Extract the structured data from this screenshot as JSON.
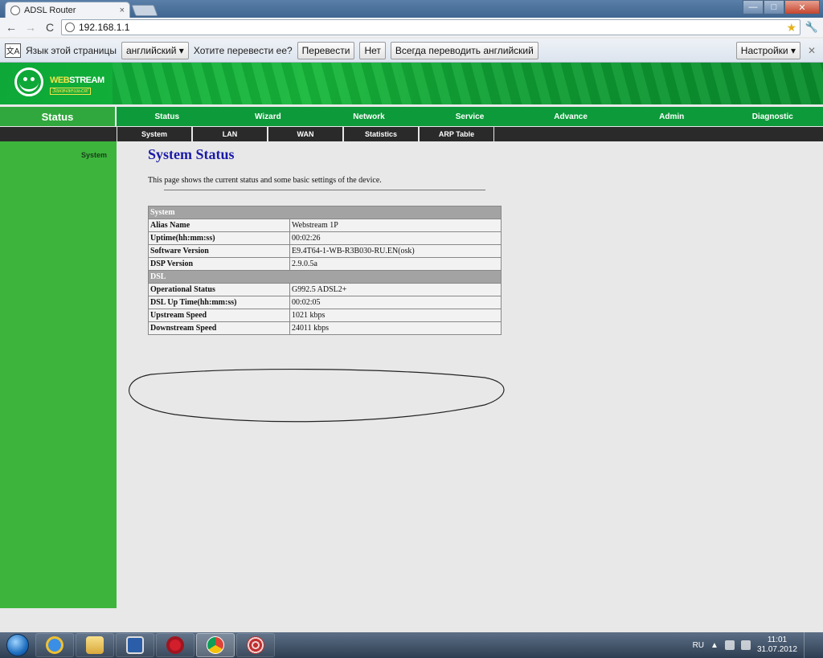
{
  "browser": {
    "tab_title": "ADSL Router",
    "tab_close": "×",
    "url": "192.168.1.1",
    "back": "←",
    "forward": "→",
    "reload": "C",
    "star": "★",
    "wrench": "🔧",
    "window_controls": {
      "minimize": "—",
      "maximize": "□",
      "close": "✕"
    }
  },
  "translate_bar": {
    "label": "Язык этой страницы",
    "language": "английский",
    "question": "Хотите перевести ее?",
    "translate_button": "Перевести",
    "no_button": "Нет",
    "always_button": "Всегда переводить английский",
    "options_button": "Настройки",
    "close": "✕"
  },
  "router": {
    "logo": {
      "brand": "WEB",
      "brand2": "STREAM",
      "tagline": "Закачаешься!"
    },
    "section": "Status",
    "main_nav": [
      "Status",
      "Wizard",
      "Network",
      "Service",
      "Advance",
      "Admin",
      "Diagnostic"
    ],
    "sub_nav": [
      "System",
      "LAN",
      "WAN",
      "Statistics",
      "ARP Table"
    ],
    "sidebar": [
      "System"
    ],
    "page_title": "System Status",
    "description": "This page shows the current status and some basic settings of the device.",
    "table": {
      "system_header": "System",
      "system_rows": [
        {
          "label": "Alias Name",
          "value": "Webstream 1P"
        },
        {
          "label": "Uptime(hh:mm:ss)",
          "value": "00:02:26"
        },
        {
          "label": "Software Version",
          "value": "E9.4T64-1-WB-R3B030-RU.EN(osk)"
        },
        {
          "label": "DSP Version",
          "value": "2.9.0.5a"
        }
      ],
      "dsl_header": "DSL",
      "dsl_rows": [
        {
          "label": "Operational Status",
          "value": "G992.5 ADSL2+"
        },
        {
          "label": "DSL Up Time(hh:mm:ss)",
          "value": "00:02:05"
        },
        {
          "label": "Upstream Speed",
          "value": "1021 kbps"
        },
        {
          "label": "Downstream Speed",
          "value": "24011 kbps"
        }
      ]
    }
  },
  "taskbar": {
    "apps": [
      "start-orb",
      "internet-explorer",
      "windows-explorer",
      "media-player",
      "opera",
      "chrome",
      "globe-app"
    ],
    "language": "RU",
    "time": "11:01",
    "date": "31.07.2012"
  }
}
